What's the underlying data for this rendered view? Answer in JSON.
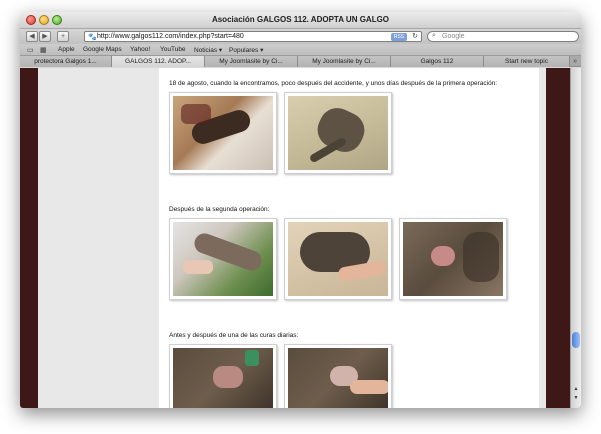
{
  "window": {
    "title": "Asociación GALGOS 112. ADOPTA UN GALGO"
  },
  "toolbar": {
    "back_icon": "◀",
    "forward_icon": "▶",
    "add_icon": "+",
    "url": "http://www.galgos112.com/index.php?start=480",
    "rss_label": "RSS",
    "search_placeholder": "Google"
  },
  "bookmarks": {
    "items": [
      "Apple",
      "Google Maps",
      "Yahoo!",
      "YouTube",
      "Noticias ▾",
      "Populares ▾"
    ]
  },
  "tabs": [
    {
      "label": "protectora Galgos 1..."
    },
    {
      "label": "GALGOS 112. ADOP..."
    },
    {
      "label": "My Joomlasite by Ci..."
    },
    {
      "label": "My Joomlasite by Ci..."
    },
    {
      "label": "Galgos 112"
    },
    {
      "label": "Start new topic"
    }
  ],
  "article": {
    "caption1": "18 de agosto, cuando la encontramos, poco después del accidente, y unos días después de la primera operación:",
    "caption2": "Después de la segunda operación:",
    "caption3": "Antes y después de una de las curas diarias:"
  },
  "colors": {
    "page_background": "#3e1717",
    "side_band": "#e8e8e8",
    "content_background": "#ffffff"
  }
}
